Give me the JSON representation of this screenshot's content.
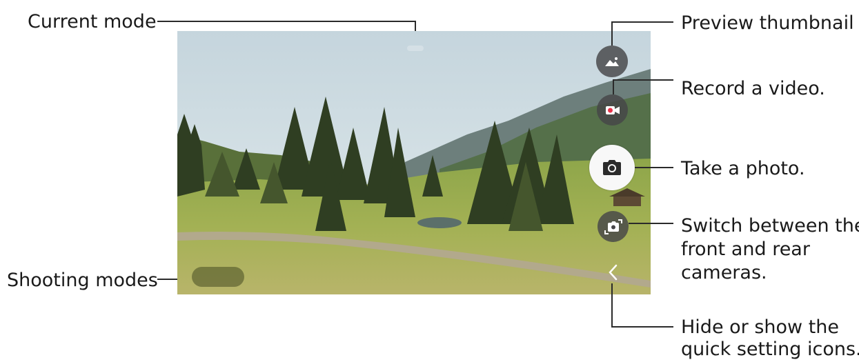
{
  "callouts": {
    "current_mode": "Current mode",
    "shooting_modes": "Shooting modes",
    "preview_thumbnail": "Preview thumbnail",
    "record_video": "Record a video.",
    "take_photo": "Take a photo.",
    "switch_cameras_line1": "Switch between the",
    "switch_cameras_line2": "front and rear",
    "switch_cameras_line3": "cameras.",
    "quick_settings_line1": "Hide or show the",
    "quick_settings_line2": "quick setting icons."
  },
  "camera": {
    "icons": {
      "preview": "preview-thumbnail-icon",
      "record": "video-camera-icon",
      "shutter": "camera-icon",
      "switch": "switch-camera-icon",
      "quick_settings": "chevron-left-icon"
    },
    "colors": {
      "record_dot": "#e8344a",
      "button_dark": "#464648",
      "button_light": "#f8f8f8"
    }
  }
}
